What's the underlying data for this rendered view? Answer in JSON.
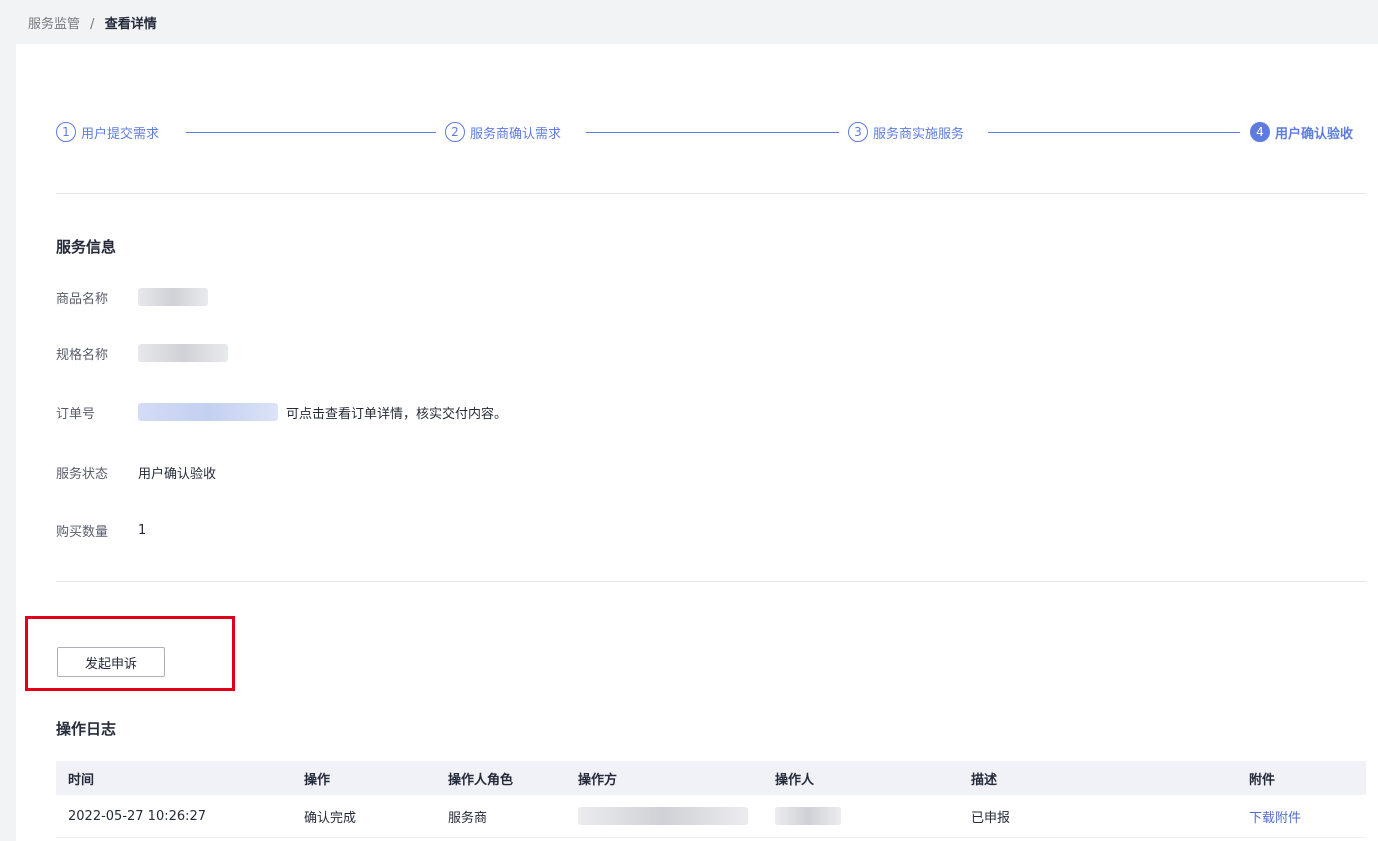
{
  "breadcrumb": {
    "parent": "服务监管",
    "separator": "/",
    "current": "查看详情"
  },
  "steps": [
    {
      "number": "1",
      "label": "用户提交需求",
      "active": false
    },
    {
      "number": "2",
      "label": "服务商确认需求",
      "active": false
    },
    {
      "number": "3",
      "label": "服务商实施服务",
      "active": false
    },
    {
      "number": "4",
      "label": "用户确认验收",
      "active": true
    }
  ],
  "service_info": {
    "title": "服务信息",
    "product_name_label": "商品名称",
    "spec_name_label": "规格名称",
    "order_no_label": "订单号",
    "order_note": "可点击查看订单详情，核实交付内容。",
    "status_label": "服务状态",
    "status_value": "用户确认验收",
    "quantity_label": "购买数量",
    "quantity_value": "1"
  },
  "appeal_button": "发起申诉",
  "log": {
    "title": "操作日志",
    "columns": [
      "时间",
      "操作",
      "操作人角色",
      "操作方",
      "操作人",
      "描述",
      "附件"
    ],
    "rows": [
      {
        "time": "2022-05-27 10:26:27",
        "action": "确认完成",
        "role": "服务商",
        "description": "已申报",
        "attachment": "下载附件"
      }
    ]
  },
  "colors": {
    "accent": "#5e7ce0",
    "highlight": "#e3001b",
    "link": "#526ecc"
  }
}
